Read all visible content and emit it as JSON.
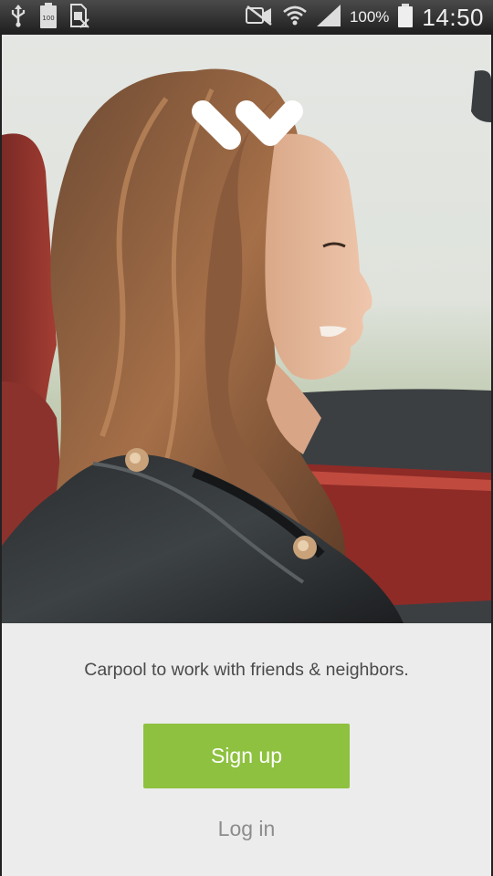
{
  "status_bar": {
    "icons_left": [
      "usb-icon",
      "battery-100-icon",
      "sim-icon"
    ],
    "icons_right": [
      "mute-icon",
      "wifi-icon",
      "signal-icon",
      "battery-icon"
    ],
    "battery_badge": "100",
    "battery_percent": "100%",
    "time": "14:50"
  },
  "hero": {
    "logo_icon": "checkmark-logo-icon",
    "photo_subject": "woman-in-convertible-photo"
  },
  "welcome": {
    "tagline": "Carpool to work with friends & neighbors.",
    "signup_label": "Sign up",
    "login_label": "Log in"
  },
  "colors": {
    "accent": "#8dc13f",
    "panel_bg": "#ececec",
    "tagline_text": "#4a4a4a",
    "login_text": "#8c8c8c"
  }
}
